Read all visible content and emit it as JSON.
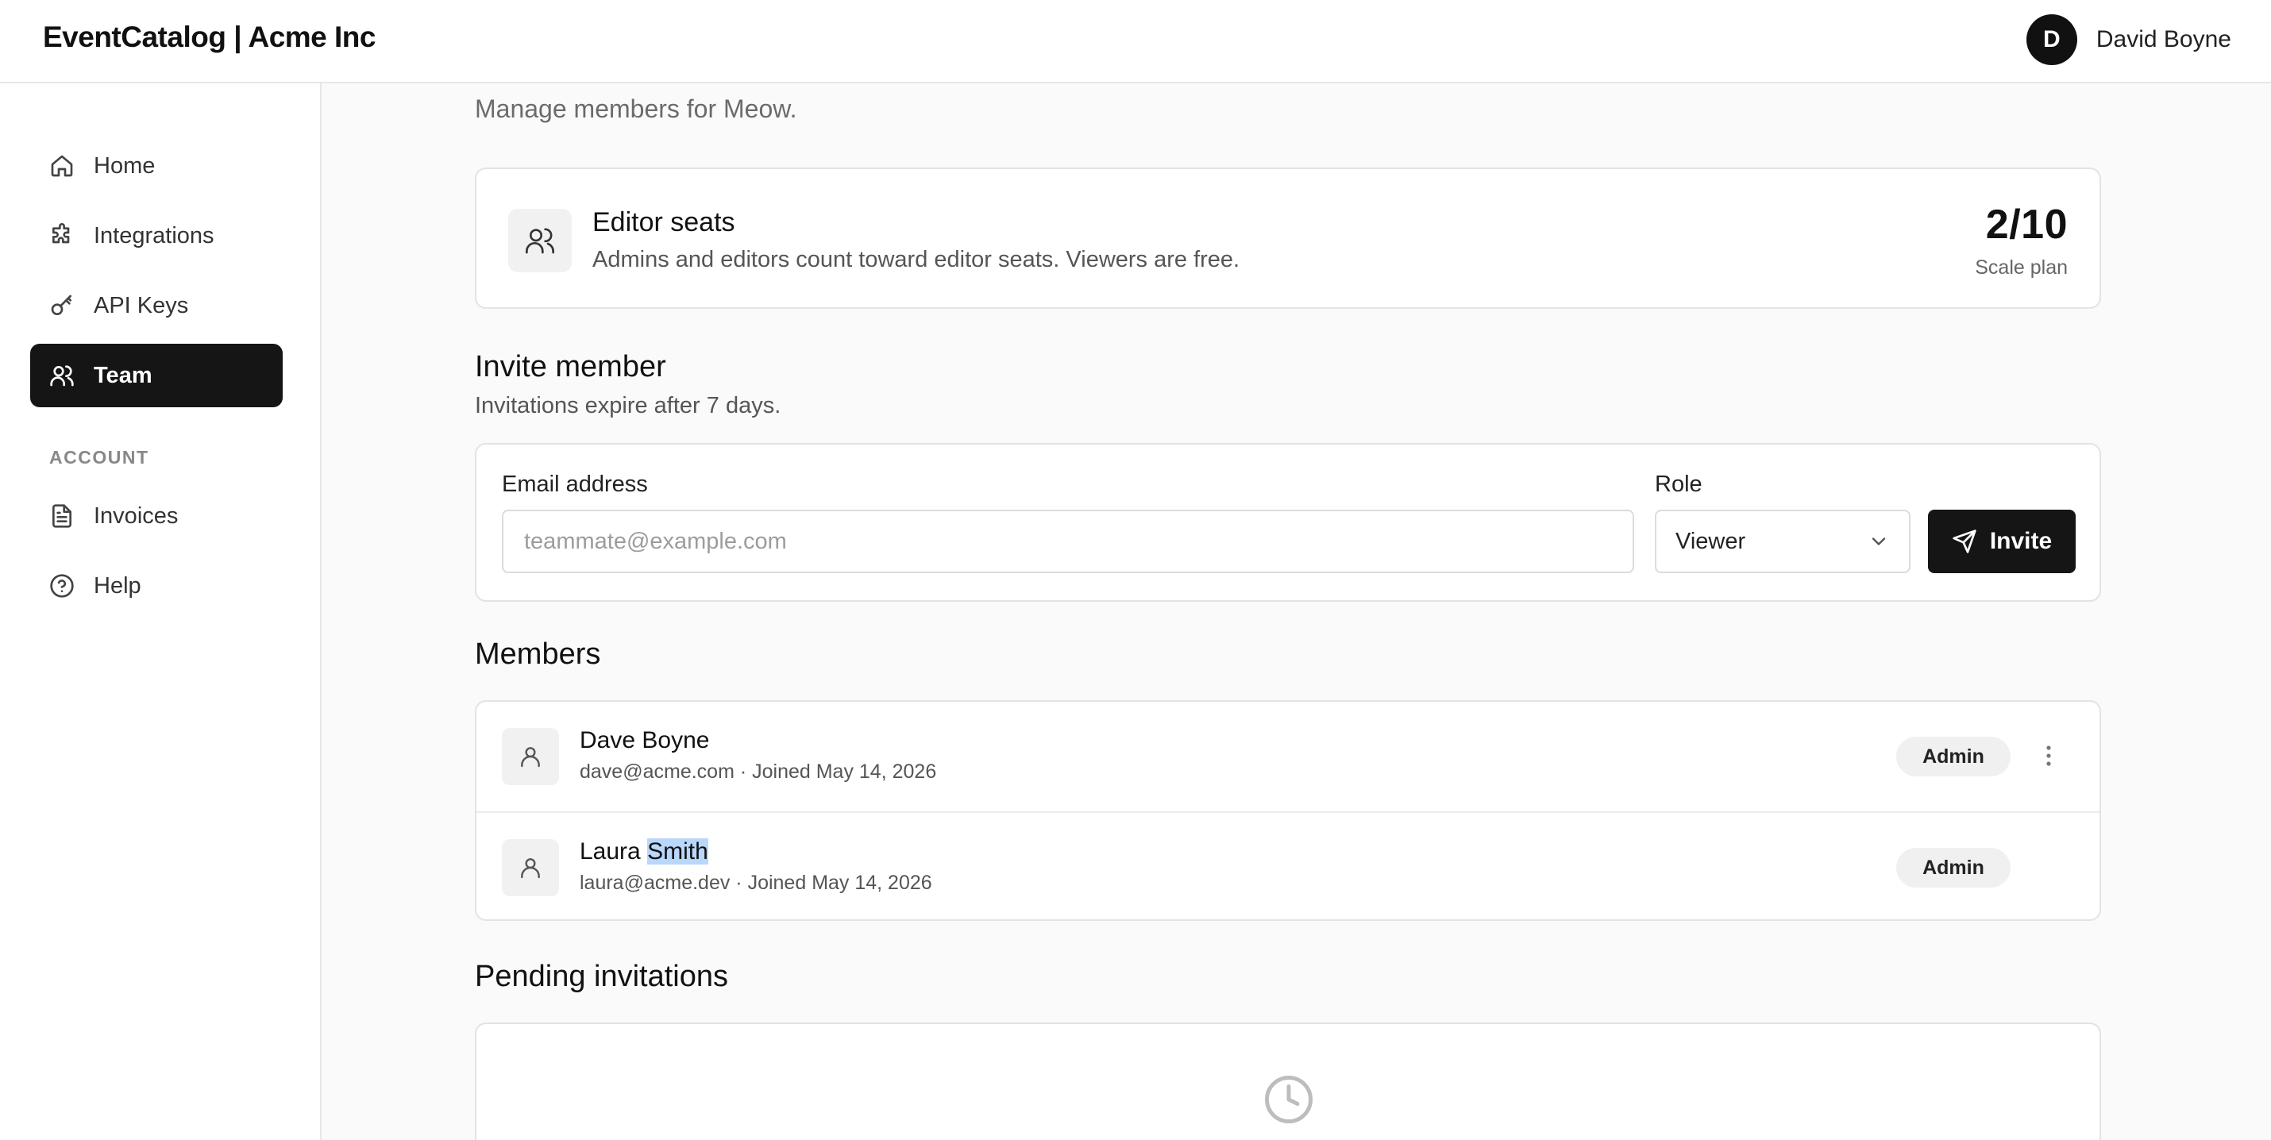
{
  "app": {
    "title": "EventCatalog | Acme Inc"
  },
  "user": {
    "initial": "D",
    "name": "David Boyne"
  },
  "sidebar": {
    "items": [
      {
        "label": "Home",
        "icon": "home-icon"
      },
      {
        "label": "Integrations",
        "icon": "puzzle-icon"
      },
      {
        "label": "API Keys",
        "icon": "key-icon"
      },
      {
        "label": "Team",
        "icon": "users-icon",
        "active": true
      }
    ],
    "account_section": "ACCOUNT",
    "account_items": [
      {
        "label": "Invoices",
        "icon": "file-text-icon"
      },
      {
        "label": "Help",
        "icon": "help-circle-icon"
      }
    ]
  },
  "page": {
    "subtitle": "Manage members for Meow."
  },
  "seats": {
    "title": "Editor seats",
    "description": "Admins and editors count toward editor seats. Viewers are free.",
    "count": "2/10",
    "plan": "Scale plan"
  },
  "invite": {
    "title": "Invite member",
    "subtitle": "Invitations expire after 7 days.",
    "email_label": "Email address",
    "email_placeholder": "teammate@example.com",
    "email_value": "",
    "role_label": "Role",
    "role_value": "Viewer",
    "button_label": "Invite"
  },
  "members": {
    "title": "Members",
    "rows": [
      {
        "first": "Dave",
        "last": "Boyne",
        "meta": "dave@acme.com · Joined May 14, 2026",
        "role": "Admin"
      },
      {
        "first": "Laura",
        "last": "Smith",
        "meta": "laura@acme.dev · Joined May 14, 2026",
        "role": "Admin"
      }
    ]
  },
  "pending": {
    "title": "Pending invitations"
  },
  "colors": {
    "accent": "#151515",
    "selection": "#b9d6fb",
    "background": "#fafafa"
  }
}
